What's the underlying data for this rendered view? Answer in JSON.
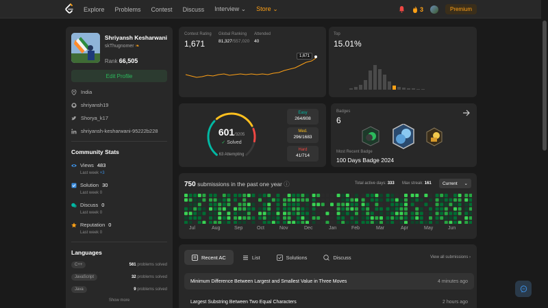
{
  "nav": {
    "links": [
      "Explore",
      "Problems",
      "Contest",
      "Discuss",
      "Interview",
      "Store"
    ],
    "streak": "3",
    "premium": "Premium"
  },
  "profile": {
    "name": "Shriyansh Kesharwani",
    "username": "skThugnomer",
    "rank_label": "Rank",
    "rank": "66,505",
    "edit_label": "Edit Profile",
    "location": "India",
    "github": "shriyansh19",
    "twitter": "Shorya_k17",
    "linkedin": "shriyansh-kesharwani-95222b228"
  },
  "community": {
    "title": "Community Stats",
    "stats": [
      {
        "label": "Views",
        "value": "483",
        "sub": "Last week",
        "delta": "+3",
        "icon": "eye-icon"
      },
      {
        "label": "Solution",
        "value": "30",
        "sub": "Last week",
        "delta": "0",
        "icon": "solution-icon"
      },
      {
        "label": "Discuss",
        "value": "0",
        "sub": "Last week",
        "delta": "0",
        "icon": "discuss-icon"
      },
      {
        "label": "Reputation",
        "value": "0",
        "sub": "Last week",
        "delta": "0",
        "icon": "star-icon"
      }
    ]
  },
  "languages": {
    "title": "Languages",
    "items": [
      {
        "name": "C++",
        "count": "561",
        "suffix": "problems solved"
      },
      {
        "name": "JavaScript",
        "count": "32",
        "suffix": "problems solved"
      },
      {
        "name": "Java",
        "count": "9",
        "suffix": "problems solved"
      }
    ],
    "show_more": "Show more"
  },
  "contest": {
    "rating_label": "Contest Rating",
    "rating": "1,671",
    "global_label": "Global Ranking",
    "global_rank": "81,327",
    "global_total": "/557,020",
    "attended_label": "Attended",
    "attended": "40",
    "tooltip": "1,671",
    "top_label": "Top",
    "top_value": "15.01%"
  },
  "solved": {
    "count": "601",
    "total": "/3205",
    "label": "Solved",
    "attempting": "63 Attempting",
    "easy_label": "Easy",
    "easy": "264/808",
    "med_label": "Med.",
    "med": "296/1683",
    "hard_label": "Hard",
    "hard": "41/714",
    "fraction": 0.1875
  },
  "badges": {
    "label": "Badges",
    "count": "6",
    "recent_label": "Most Recent Badge",
    "recent": "100 Days Badge 2024"
  },
  "submissions": {
    "count": "750",
    "text": "submissions in the past one year",
    "active_label": "Total active days:",
    "active": "333",
    "streak_label": "Max streak:",
    "streak": "161",
    "period": "Current",
    "months": [
      "Jul",
      "Aug",
      "Sep",
      "Oct",
      "Nov",
      "Dec",
      "Jan",
      "Feb",
      "Mar",
      "Apr",
      "May",
      "Jun"
    ]
  },
  "tabs": {
    "items": [
      "Recent AC",
      "List",
      "Solutions",
      "Discuss"
    ],
    "view_all": "View all submissions"
  },
  "recent": [
    {
      "title": "Minimum Difference Between Largest and Smallest Value in Three Moves",
      "ago": "4 minutes ago"
    },
    {
      "title": "Largest Substring Between Two Equal Characters",
      "ago": "2 hours ago"
    }
  ],
  "colors": {
    "easy": "#00b8a3",
    "medium": "#ffc01e",
    "hard": "#ef4743",
    "accent": "#ffa116",
    "green": "#2cbb5d"
  }
}
